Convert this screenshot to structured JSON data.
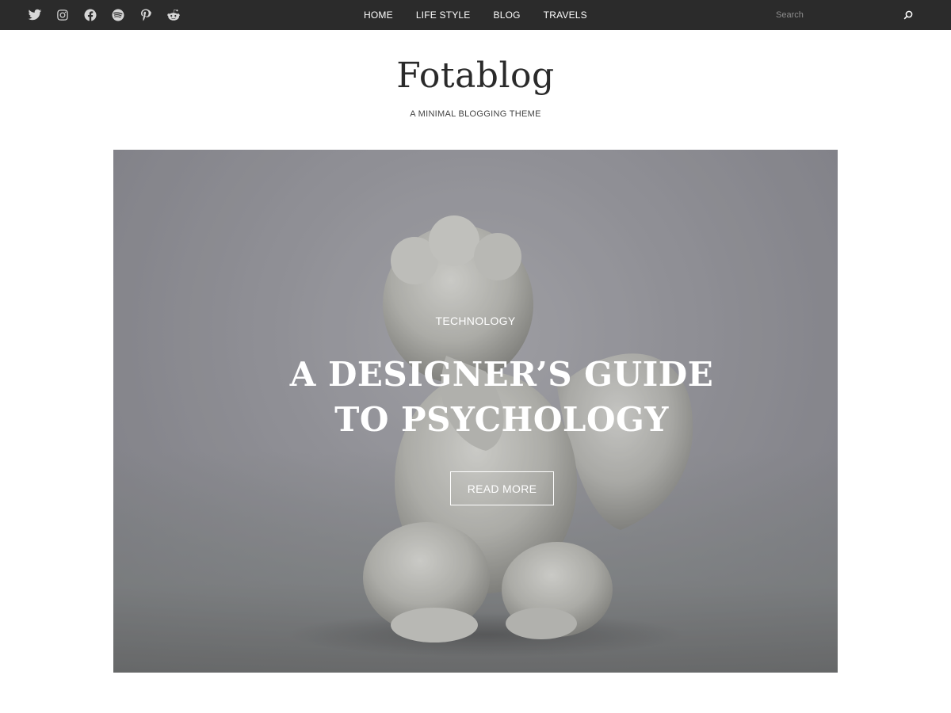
{
  "social": [
    {
      "name": "twitter-icon"
    },
    {
      "name": "instagram-icon"
    },
    {
      "name": "facebook-icon"
    },
    {
      "name": "spotify-icon"
    },
    {
      "name": "pinterest-icon"
    },
    {
      "name": "reddit-icon"
    }
  ],
  "nav": {
    "items": [
      {
        "label": "HOME"
      },
      {
        "label": "LIFE STYLE"
      },
      {
        "label": "BLOG"
      },
      {
        "label": "TRAVELS"
      }
    ]
  },
  "search": {
    "placeholder": "Search",
    "icon": "search-icon"
  },
  "site": {
    "title": "Fotablog",
    "tagline": "A MINIMAL BLOGGING THEME"
  },
  "hero": {
    "category": "TECHNOLOGY",
    "title": "A DESIGNER’S GUIDE TO PSYCHOLOGY",
    "button": "READ MORE",
    "image": "cherub-statue-photo"
  },
  "colors": {
    "topbar": "#2b2b2b",
    "text_dark": "#2a2a2a",
    "white": "#ffffff"
  }
}
